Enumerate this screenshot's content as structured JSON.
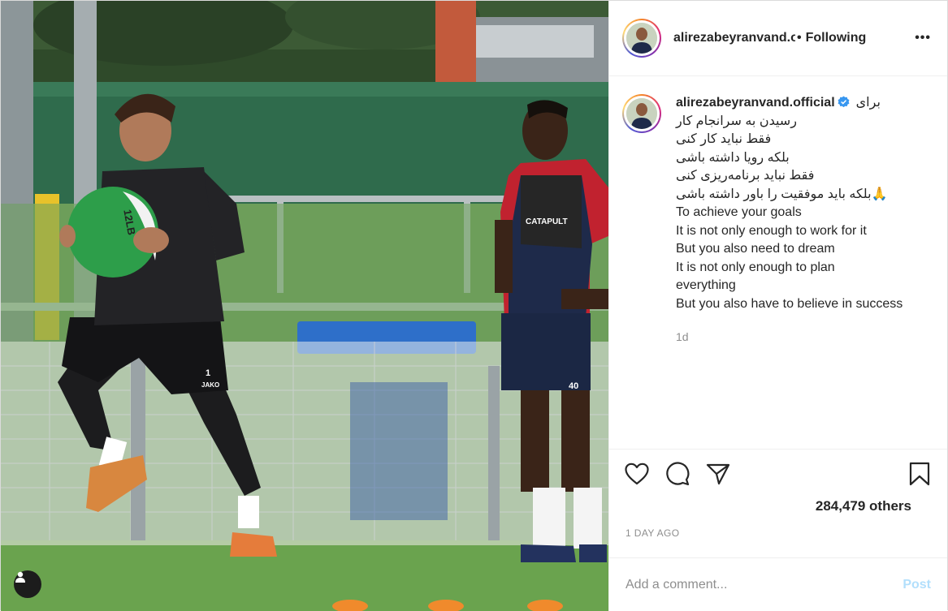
{
  "post": {
    "username": "alirezabeyranvand.official",
    "header_username_display": "alirezabeyranvand.offici",
    "header_separator": "•",
    "follow_label": "Following",
    "more_label": "•••",
    "verified": true,
    "caption_first_line": "برای",
    "caption_lines": [
      "رسیدن به سرانجام کار",
      "فقط نباید کار کنی",
      "بلکه رویا داشته باشی",
      "فقط نباید برنامه‌ریزی کنی",
      "🙏بلکه باید موفقیت را باور داشته باشی",
      "To achieve your goals",
      "It is not only enough to work for it",
      "But you also need to dream",
      "It is not only enough to plan",
      "everything",
      "But you also have to believe in success"
    ],
    "caption_time": "1d",
    "likes": "284,479 others",
    "post_age": "1 DAY AGO",
    "comment_placeholder": "Add a comment...",
    "post_button": "Post"
  },
  "icons": {
    "like": "heart-icon",
    "comment": "comment-bubble-icon",
    "share": "paper-plane-icon",
    "save": "bookmark-icon",
    "user_tag": "user-tag-icon",
    "verified": "verified-badge-icon"
  },
  "colors": {
    "text": "#262626",
    "muted": "#8e8e8e",
    "border": "#efefef",
    "verified": "#3897f0",
    "post_button_disabled": "#b2dffc"
  },
  "media": {
    "ball_label": "12LB",
    "left_player_number": "1",
    "right_player_number": "40",
    "sponsor": "CATAPULT",
    "kit_brand": "JAKO"
  }
}
